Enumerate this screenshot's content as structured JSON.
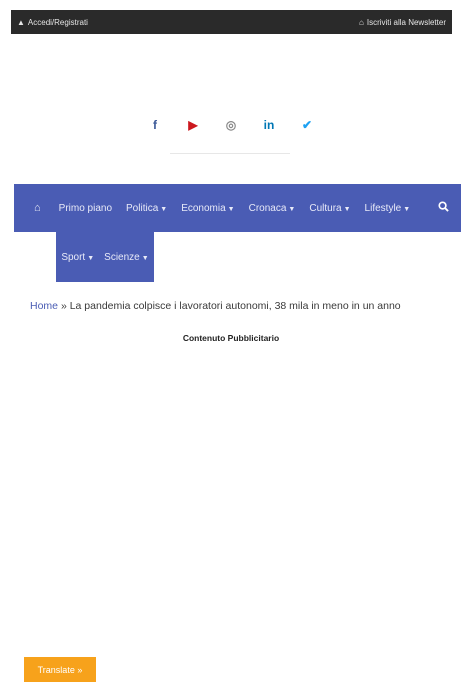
{
  "topbar": {
    "login_icon": "user-icon",
    "login_label": "Accedi/Registrati",
    "newsletter_icon": "home-icon",
    "newsletter_label": "Iscriviti alla Newsletter"
  },
  "social": [
    {
      "name": "facebook-icon",
      "glyph": "f",
      "color": "#3b5998"
    },
    {
      "name": "youtube-icon",
      "glyph": "▶",
      "color": "#cc181e"
    },
    {
      "name": "instagram-icon",
      "glyph": "◎",
      "color": "#8a8a8a"
    },
    {
      "name": "linkedin-icon",
      "glyph": "in",
      "color": "#0077b5"
    },
    {
      "name": "twitter-icon",
      "glyph": "✔",
      "color": "#1da1f2"
    }
  ],
  "nav": {
    "home_glyph": "⌂",
    "items": [
      {
        "label": "Primo piano",
        "caret": false
      },
      {
        "label": "Politica",
        "caret": true
      },
      {
        "label": "Economia",
        "caret": true
      },
      {
        "label": "Cronaca",
        "caret": true
      },
      {
        "label": "Cultura",
        "caret": true
      },
      {
        "label": "Lifestyle",
        "caret": true
      }
    ],
    "search_glyph": "🔍",
    "subitems": [
      {
        "label": "Sport",
        "caret": true
      },
      {
        "label": "Scienze",
        "caret": true
      }
    ]
  },
  "breadcrumb": {
    "home": "Home",
    "separator": "»",
    "current": "La pandemia colpisce i lavoratori autonomi, 38 mila in meno in un anno"
  },
  "ad_label": "Contenuto Pubblicitario",
  "translate": {
    "label": "Translate",
    "arrow": "»"
  },
  "colors": {
    "nav_bg": "#4a5cb4",
    "topbar_bg": "#2a2a2a",
    "translate_bg": "#f7a21b"
  }
}
